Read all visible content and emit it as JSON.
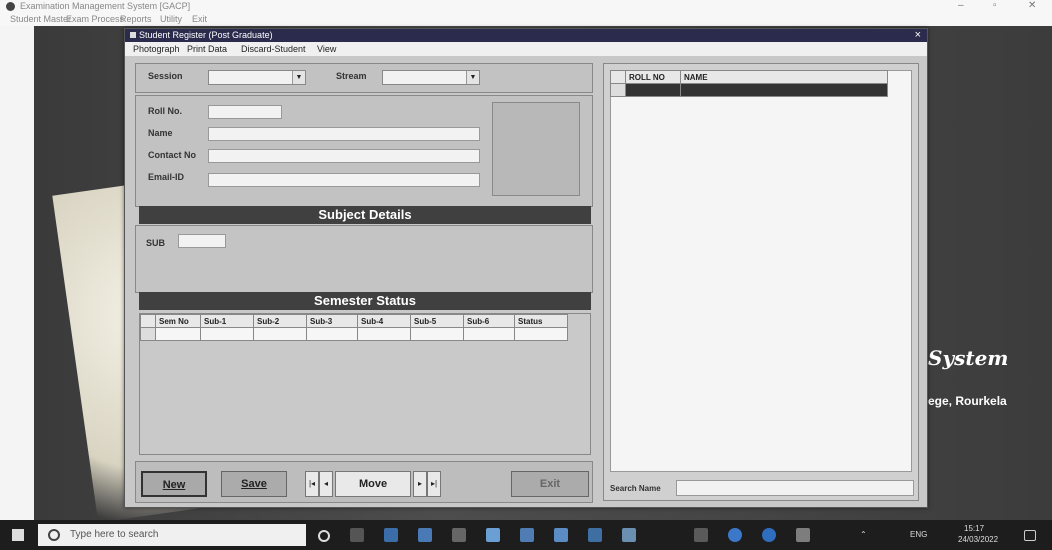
{
  "app": {
    "title": "Examination Management System [GACP]",
    "menu": [
      "Student Master",
      "Exam Process",
      "Reports",
      "Utility",
      "Exit"
    ],
    "window_controls": [
      "–",
      "▫",
      "✕"
    ]
  },
  "background": {
    "system_text": "System",
    "college_text": "ege, Rourkela"
  },
  "dialog": {
    "title": "Student Register (Post Graduate)",
    "close": "×",
    "menu": [
      "Photograph",
      "Print Data",
      "Discard-Student",
      "View"
    ],
    "session_label": "Session",
    "stream_label": "Stream",
    "session_value": "",
    "stream_value": "",
    "roll_label": "Roll No.",
    "name_label": "Name",
    "contact_label": "Contact No",
    "email_label": "Email-ID",
    "subject_details": "Subject Details",
    "sub_label": "SUB",
    "semester_status": "Semester Status",
    "sem_columns": [
      "Sem No",
      "Sub-1",
      "Sub-2",
      "Sub-3",
      "Sub-4",
      "Sub-5",
      "Sub-6",
      "Status"
    ],
    "right_columns": [
      "ROLL NO",
      "NAME"
    ],
    "search_label": "Search Name",
    "buttons": {
      "new": "New",
      "save": "Save",
      "move": "Move",
      "exit": "Exit",
      "first": "|◂",
      "prev": "◂",
      "next": "▸",
      "last": "▸|"
    }
  },
  "taskbar": {
    "search_placeholder": "Type here to search",
    "lang": "ENG",
    "time": "15:17",
    "date": "24/03/2022"
  }
}
